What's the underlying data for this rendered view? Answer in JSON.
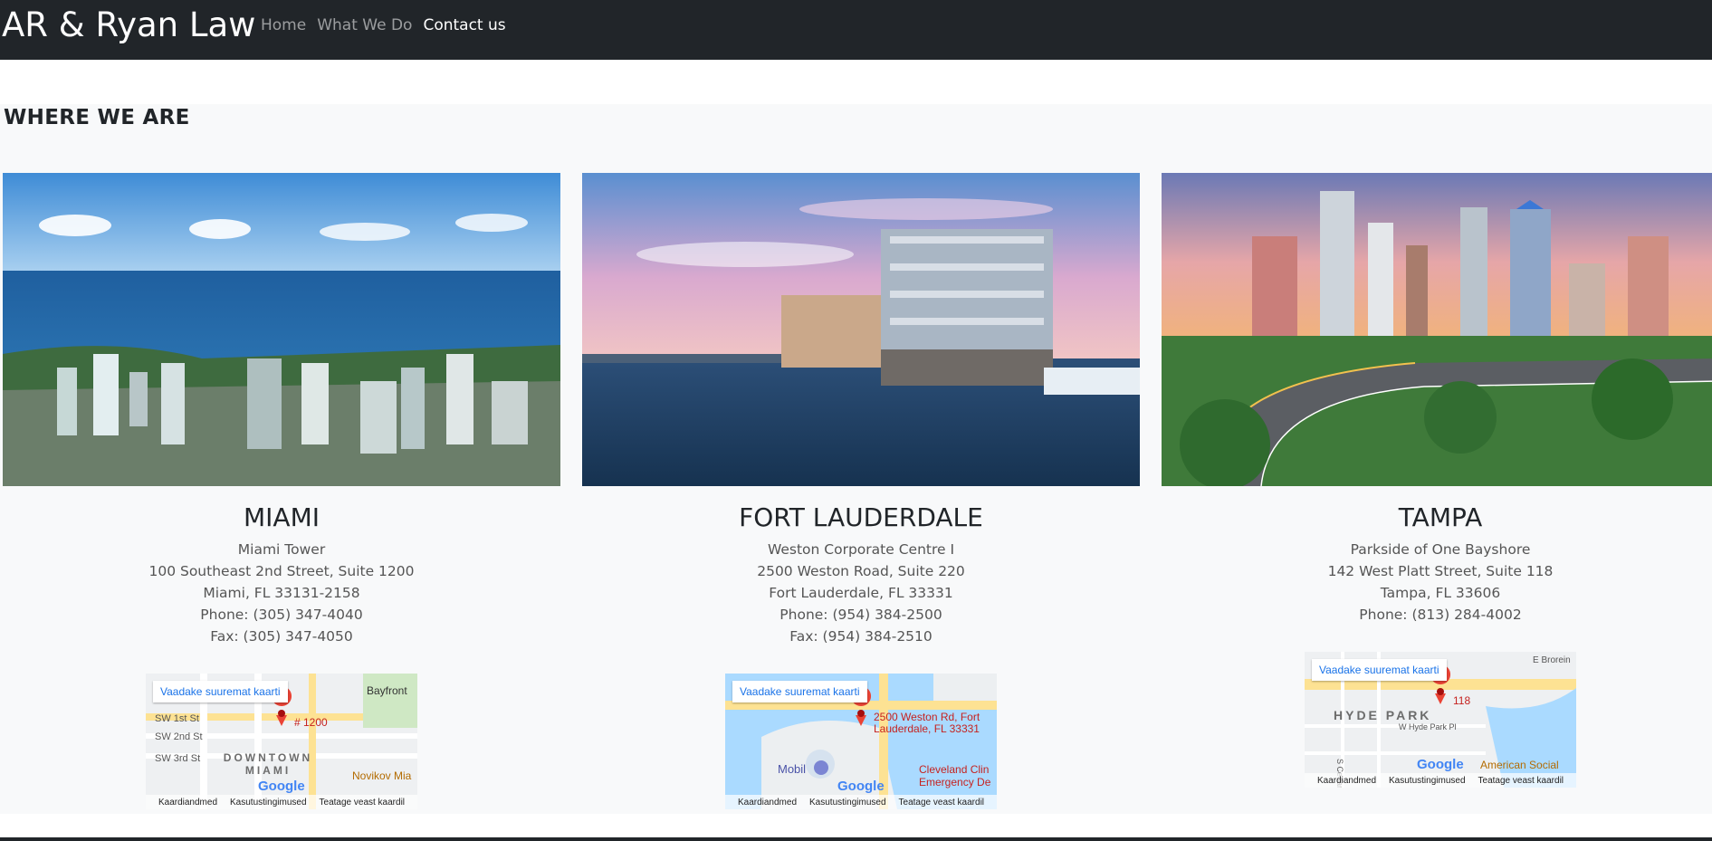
{
  "brand": "AR & Ryan Law",
  "nav": [
    {
      "label": "Home",
      "active": false
    },
    {
      "label": "What We Do",
      "active": false
    },
    {
      "label": "Contact us",
      "active": true
    }
  ],
  "section": {
    "title": "WHERE WE ARE"
  },
  "locations": [
    {
      "city": "MIAMI",
      "lines": [
        "Miami Tower",
        "100 Southeast 2nd Street, Suite 1200",
        "Miami, FL 33131-2158",
        "Phone: (305) 347-4040",
        "Fax: (305) 347-4050"
      ],
      "map": {
        "button": "Vaadake suuremat kaarti",
        "pin_label": "# 1200",
        "streets": [
          "SW 1st St",
          "SW 2nd St",
          "SW 3rd St"
        ],
        "area": "DOWNTOWN MIAMI",
        "poi": [
          "Bayfront",
          "Novikov Mia"
        ]
      }
    },
    {
      "city": "FORT LAUDERDALE",
      "lines": [
        "Weston Corporate Centre I",
        "2500 Weston Road, Suite 220",
        "Fort Lauderdale, FL 33331",
        "Phone: (954) 384-2500",
        "Fax: (954) 384-2510"
      ],
      "map": {
        "button": "Vaadake suuremat kaarti",
        "pin_label": "2500 Weston Rd, Fort Lauderdale, FL 33331",
        "poi": [
          "Mobil",
          "Cleveland Clin",
          "Emergency De"
        ]
      }
    },
    {
      "city": "TAMPA",
      "lines": [
        "Parkside of One Bayshore",
        "142 West Platt Street, Suite 118",
        "Tampa, FL 33606",
        "Phone: (813) 284-4002"
      ],
      "map": {
        "button": "Vaadake suuremat kaarti",
        "pin_label": "118",
        "area": "HYDE PARK",
        "streets": [
          "W Hyde Park Pl",
          "S Cedar Ave",
          "E Brorein"
        ],
        "poi": [
          "American Social"
        ]
      }
    }
  ],
  "map_footer": [
    "Kaardiandmed",
    "Kasutustingimused",
    "Teatage veast kaardil"
  ],
  "google_logo": "Google"
}
